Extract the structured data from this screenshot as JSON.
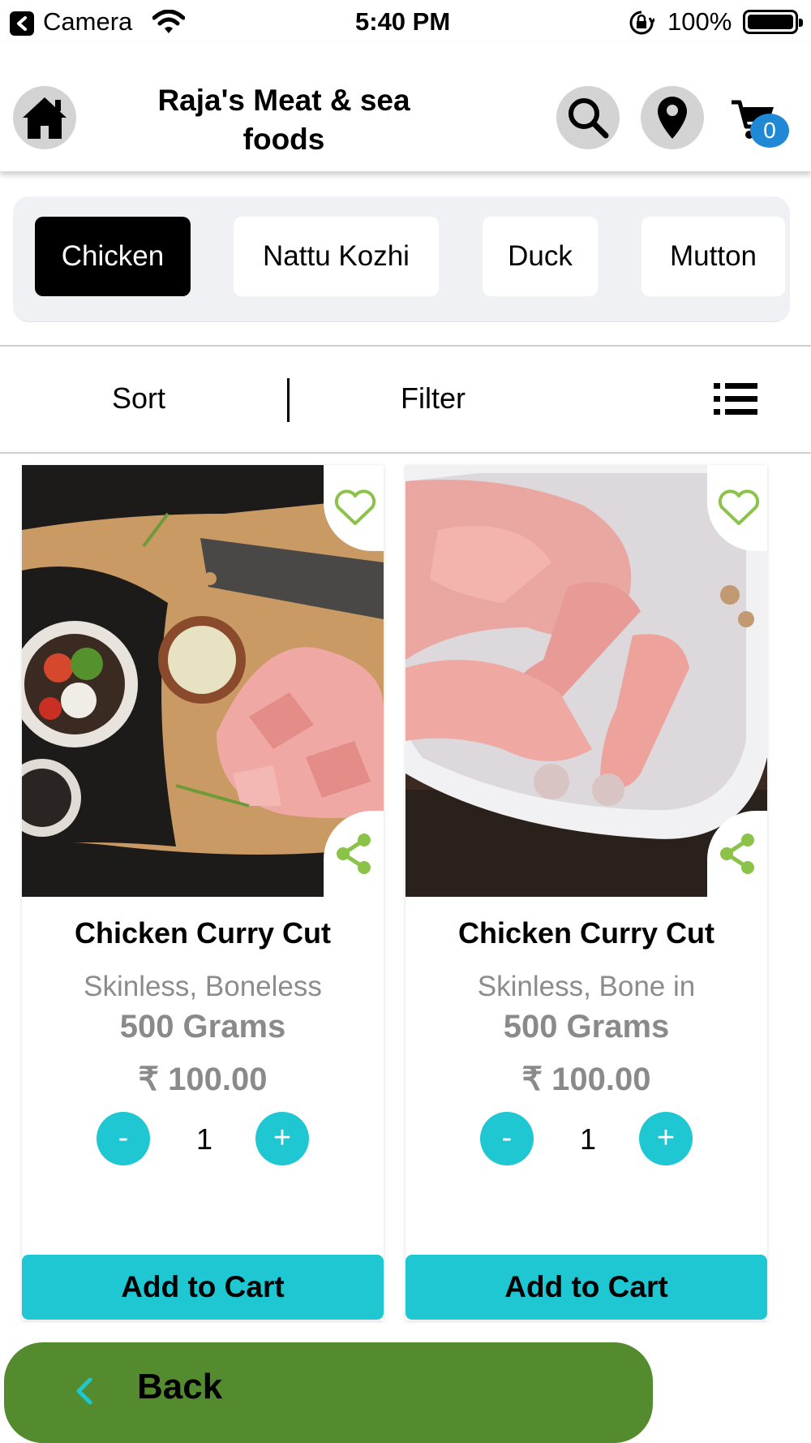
{
  "status_bar": {
    "back_app": "Camera",
    "time": "5:40 PM",
    "battery": "100%"
  },
  "header": {
    "title": "Raja's Meat & sea foods",
    "cart_count": "0"
  },
  "categories": [
    {
      "label": "Chicken",
      "active": true
    },
    {
      "label": "Nattu Kozhi",
      "active": false
    },
    {
      "label": "Duck",
      "active": false
    },
    {
      "label": "Mutton",
      "active": false
    }
  ],
  "toolbar": {
    "sort_label": "Sort",
    "filter_label": "Filter"
  },
  "products": [
    {
      "name": "Chicken Curry Cut",
      "description": "Skinless, Boneless",
      "weight": "500 Grams",
      "price": "₹ 100.00",
      "quantity": "1",
      "minus": "-",
      "plus": "+",
      "add_to_cart": "Add to Cart"
    },
    {
      "name": "Chicken Curry Cut",
      "description": "Skinless, Bone in",
      "weight": "500 Grams",
      "price": "₹ 100.00",
      "quantity": "1",
      "minus": "-",
      "plus": "+",
      "add_to_cart": "Add to Cart"
    }
  ],
  "footer": {
    "back_label": "Back"
  },
  "colors": {
    "accent": "#1ec7d2",
    "back_bar": "#558b2f",
    "badge": "#1f89d6",
    "favorite": "#8bc34a"
  }
}
